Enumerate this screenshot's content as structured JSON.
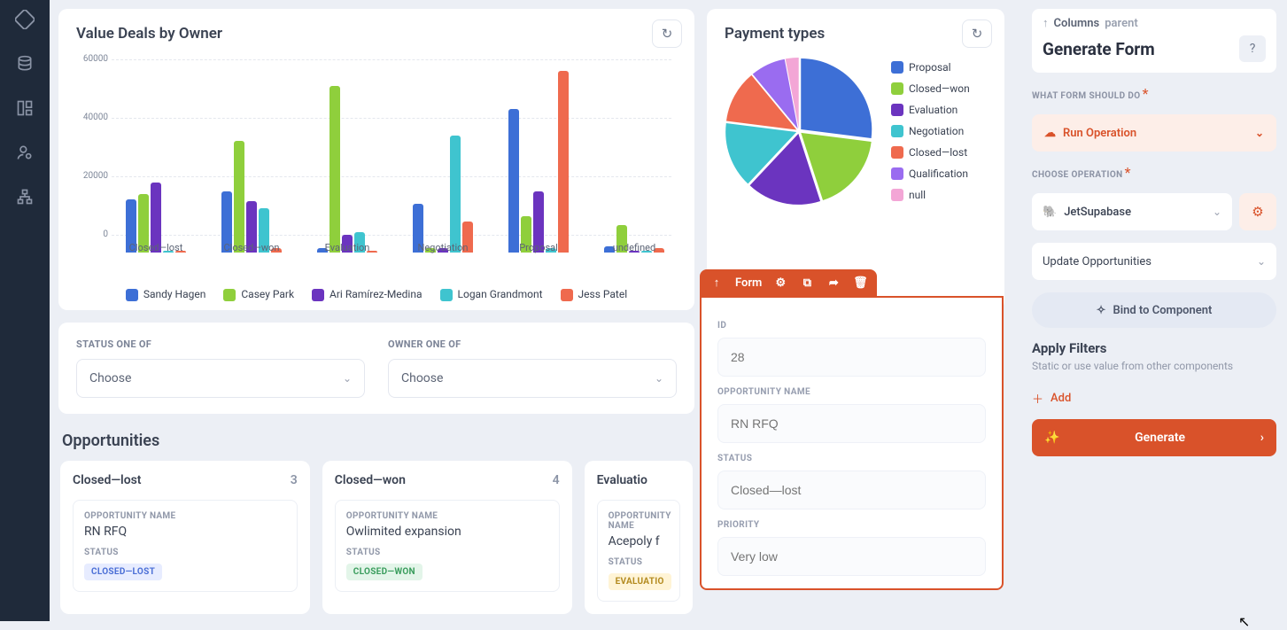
{
  "rail": {
    "icons": [
      "ruler-icon",
      "database-icon",
      "layout-icon",
      "user-cog-icon",
      "sitemap-icon"
    ]
  },
  "charts": {
    "bar": {
      "title": "Value Deals by Owner",
      "categories": [
        "Closed—lost",
        "Closed—won",
        "Evaluation",
        "Negotiation",
        "Proposal",
        "undefined"
      ],
      "series": [
        {
          "name": "Sandy Hagen",
          "color": "#3d6fd6"
        },
        {
          "name": "Casey Park",
          "color": "#8fcf3c"
        },
        {
          "name": "Ari Ramírez-Medina",
          "color": "#6b34bf"
        },
        {
          "name": "Logan Grandmont",
          "color": "#3fc4cf"
        },
        {
          "name": "Jess Patel",
          "color": "#ef6a4e"
        }
      ],
      "ymax": 60000,
      "yticks": [
        0,
        20000,
        40000,
        60000
      ]
    },
    "pie": {
      "title": "Payment types",
      "items": [
        {
          "label": "Proposal",
          "color": "#3d6fd6"
        },
        {
          "label": "Closed—won",
          "color": "#8fcf3c"
        },
        {
          "label": "Evaluation",
          "color": "#6b34bf"
        },
        {
          "label": "Negotiation",
          "color": "#3fc4cf"
        },
        {
          "label": "Closed—lost",
          "color": "#ef6a4e"
        },
        {
          "label": "Qualification",
          "color": "#9a6cf0"
        },
        {
          "label": "null",
          "color": "#f3a6d6"
        }
      ]
    }
  },
  "chart_data": [
    {
      "type": "bar",
      "title": "Value Deals by Owner",
      "xlabel": "",
      "ylabel": "",
      "ylim": [
        0,
        62000
      ],
      "yticks": [
        0,
        20000,
        40000,
        60000
      ],
      "categories": [
        "Closed—lost",
        "Closed—won",
        "Evaluation",
        "Negotiation",
        "Proposal",
        "undefined"
      ],
      "series": [
        {
          "name": "Sandy Hagen",
          "color": "#3d6fd6",
          "values": [
            18000,
            21000,
            1500,
            16500,
            49000,
            2000
          ]
        },
        {
          "name": "Casey Park",
          "color": "#8fcf3c",
          "values": [
            20000,
            38000,
            57000,
            1500,
            12500,
            9500
          ]
        },
        {
          "name": "Ari Ramírez-Medina",
          "color": "#6b34bf",
          "values": [
            24000,
            17500,
            6000,
            1500,
            21000,
            500
          ]
        },
        {
          "name": "Logan Grandmont",
          "color": "#3fc4cf",
          "values": [
            500,
            15000,
            7000,
            40000,
            1500,
            500
          ]
        },
        {
          "name": "Jess Patel",
          "color": "#ef6a4e",
          "values": [
            500,
            1500,
            500,
            10500,
            62000,
            1500
          ]
        }
      ]
    },
    {
      "type": "pie",
      "title": "Payment types",
      "slices": [
        {
          "label": "Proposal",
          "color": "#3d6fd6",
          "value": 27
        },
        {
          "label": "Closed—won",
          "color": "#8fcf3c",
          "value": 18
        },
        {
          "label": "Evaluation",
          "color": "#6b34bf",
          "value": 17
        },
        {
          "label": "Negotiation",
          "color": "#3fc4cf",
          "value": 15
        },
        {
          "label": "Closed—lost",
          "color": "#ef6a4e",
          "value": 12
        },
        {
          "label": "Qualification",
          "color": "#9a6cf0",
          "value": 8
        },
        {
          "label": "null",
          "color": "#f3a6d6",
          "value": 3
        }
      ]
    }
  ],
  "filters": {
    "status": {
      "label": "STATUS ONE OF",
      "placeholder": "Choose"
    },
    "owner": {
      "label": "OWNER ONE OF",
      "placeholder": "Choose"
    }
  },
  "opps": {
    "heading": "Opportunities",
    "cols": [
      {
        "title": "Closed—lost",
        "count": "3",
        "card": {
          "k1": "OPPORTUNITY NAME",
          "v1": "RN RFQ",
          "k2": "STATUS",
          "badge": "CLOSED—LOST",
          "cls": "lost"
        }
      },
      {
        "title": "Closed—won",
        "count": "4",
        "card": {
          "k1": "OPPORTUNITY NAME",
          "v1": "Owlimited expansion",
          "k2": "STATUS",
          "badge": "CLOSED—WON",
          "cls": "won"
        }
      },
      {
        "title": "Evaluatio",
        "count": "",
        "card": {
          "k1": "OPPORTUNITY NAME",
          "v1": "Acepoly f",
          "k2": "STATUS",
          "badge": "EVALUATIO",
          "cls": "eval"
        }
      }
    ]
  },
  "form": {
    "header_label": "Form",
    "fields": {
      "id": {
        "label": "ID",
        "value": "28"
      },
      "name": {
        "label": "OPPORTUNITY NAME",
        "value": "RN RFQ"
      },
      "status": {
        "label": "STATUS",
        "value": "Closed—lost"
      },
      "priority": {
        "label": "PRIORITY",
        "value": "Very low"
      }
    }
  },
  "right": {
    "crumb_prefix": "Columns",
    "crumb_parent": "parent",
    "title": "Generate Form",
    "whatdo": "WHAT FORM SHOULD DO",
    "runop": "Run Operation",
    "chooseop": "CHOOSE OPERATION",
    "opname": "JetSupabase",
    "subop": "Update Opportunities",
    "bind": "Bind to Component",
    "filters_head": "Apply Filters",
    "filters_sub": "Static or use value from other components",
    "add": "Add",
    "generate": "Generate"
  }
}
